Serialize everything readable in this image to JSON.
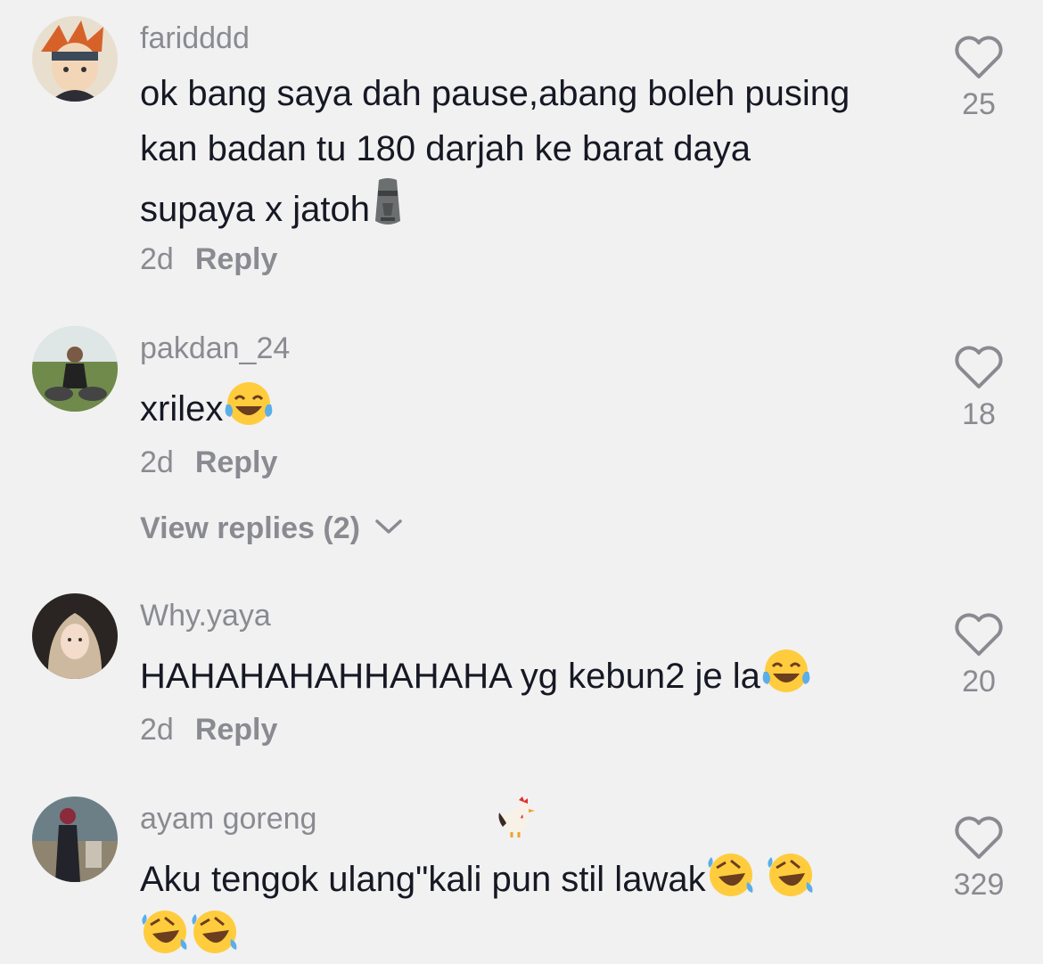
{
  "comments": [
    {
      "username": "faridddd",
      "text": "ok bang saya dah pause,abang boleh pusing kan badan tu 180 darjah ke barat daya supaya x jatoh",
      "emoji": "moai",
      "time": "2d",
      "reply_label": "Reply",
      "likes": "25"
    },
    {
      "username": "pakdan_24",
      "text": "xrilex",
      "emoji": "tears-of-joy",
      "time": "2d",
      "reply_label": "Reply",
      "likes": "18",
      "view_replies": "View replies (2)"
    },
    {
      "username": "Why.yaya",
      "text": "HAHAHAHAHHAHAHA yg kebun2 je la",
      "emoji": "tears-of-joy",
      "time": "2d",
      "reply_label": "Reply",
      "likes": "20"
    },
    {
      "username": "ayam goreng",
      "username_emoji": "rooster",
      "text": "Aku tengok ulang\"kali pun stil lawak",
      "emoji": "rofl",
      "time": "",
      "reply_label": "",
      "likes": "329"
    }
  ],
  "colors": {
    "background": "#f1f1f2",
    "text": "#161823",
    "muted": "#8a8b91"
  }
}
